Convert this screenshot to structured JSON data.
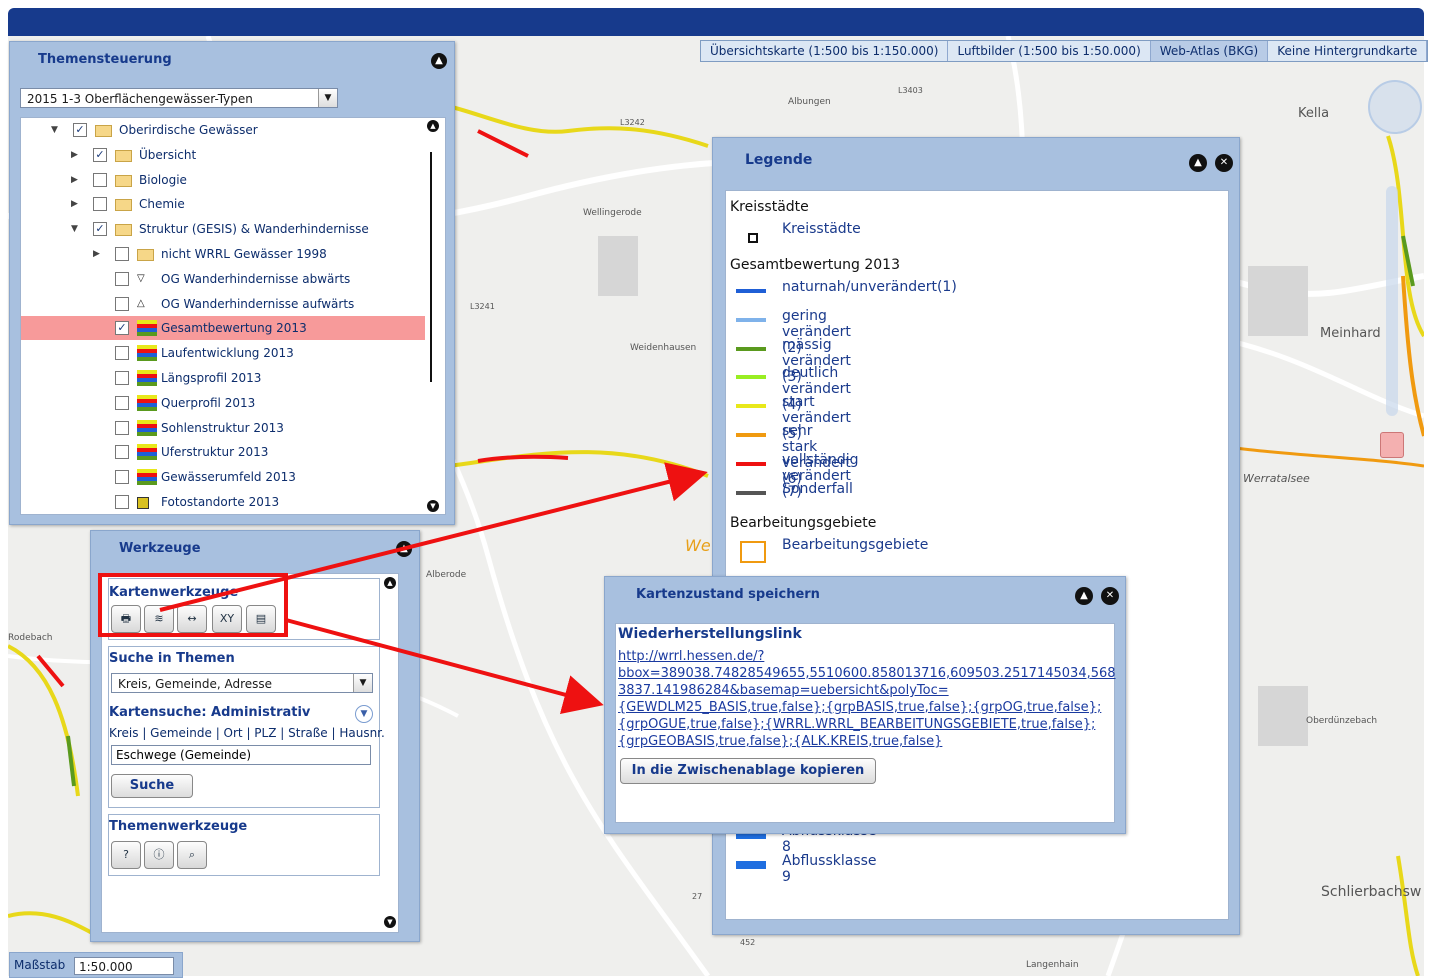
{
  "basemap_tabs": [
    {
      "label": "Übersichtskarte (1:500 bis 1:150.000)",
      "active": false
    },
    {
      "label": "Luftbilder (1:500 bis 1:50.000)",
      "active": false
    },
    {
      "label": "Web-Atlas (BKG)",
      "active": true
    },
    {
      "label": "Keine Hintergrundkarte",
      "active": false
    }
  ],
  "map_labels": {
    "kella": "Kella",
    "meinhard": "Meinhard",
    "schlierbach": "Schlierbachsw",
    "werratalsee": "Werratalsee",
    "we": "We",
    "alberode": "Alberode",
    "rodebach": "Rodebach",
    "weidenhausen": "Weidenhausen",
    "wellingerode": "Wellingerode",
    "langenhain": "Langenhain",
    "oberduenzebach": "Oberdünzebach",
    "albungen": "Albungen",
    "l3242": "L3242",
    "l3241": "L3241",
    "l3403": "L3403",
    "n452": "452",
    "n27": "27"
  },
  "themen": {
    "title": "Themensteuerung",
    "dropdown": "2015 1-3 Oberflächengewässer-Typen",
    "tree": [
      {
        "label": "Oberirdische Gewässer",
        "indent": 0,
        "arrow": "▼",
        "checked": true,
        "icon": "folder-open"
      },
      {
        "label": "Übersicht",
        "indent": 1,
        "arrow": "▶",
        "checked": true,
        "icon": "folder"
      },
      {
        "label": "Biologie",
        "indent": 1,
        "arrow": "▶",
        "checked": false,
        "icon": "folder"
      },
      {
        "label": "Chemie",
        "indent": 1,
        "arrow": "▶",
        "checked": false,
        "icon": "folder"
      },
      {
        "label": "Struktur (GESIS) & Wanderhindernisse",
        "indent": 1,
        "arrow": "▼",
        "checked": true,
        "icon": "folder-open"
      },
      {
        "label": "nicht WRRL Gewässer 1998",
        "indent": 2,
        "arrow": "▶",
        "checked": false,
        "icon": "folder"
      },
      {
        "label": "OG Wanderhindernisse abwärts",
        "indent": 2,
        "arrow": "",
        "checked": false,
        "icon": "triangle-down"
      },
      {
        "label": "OG Wanderhindernisse aufwärts",
        "indent": 2,
        "arrow": "",
        "checked": false,
        "icon": "triangle-up"
      },
      {
        "label": "Gesamtbewertung 2013",
        "indent": 2,
        "arrow": "",
        "checked": true,
        "icon": "ramp",
        "selected": true
      },
      {
        "label": "Laufentwicklung 2013",
        "indent": 2,
        "arrow": "",
        "checked": false,
        "icon": "ramp"
      },
      {
        "label": "Längsprofil 2013",
        "indent": 2,
        "arrow": "",
        "checked": false,
        "icon": "ramp"
      },
      {
        "label": "Querprofil 2013",
        "indent": 2,
        "arrow": "",
        "checked": false,
        "icon": "ramp"
      },
      {
        "label": "Sohlenstruktur 2013",
        "indent": 2,
        "arrow": "",
        "checked": false,
        "icon": "ramp"
      },
      {
        "label": "Uferstruktur 2013",
        "indent": 2,
        "arrow": "",
        "checked": false,
        "icon": "ramp"
      },
      {
        "label": "Gewässerumfeld 2013",
        "indent": 2,
        "arrow": "",
        "checked": false,
        "icon": "ramp"
      },
      {
        "label": "Fotostandorte 2013",
        "indent": 2,
        "arrow": "",
        "checked": false,
        "icon": "square"
      }
    ]
  },
  "werkzeuge": {
    "title": "Werkzeuge",
    "kartenwerkzeuge": "Kartenwerkzeuge",
    "tools": [
      "print-icon",
      "layers-icon",
      "measure-icon",
      "coordinates-icon",
      "document-icon"
    ],
    "tool_glyphs": [
      "🖶",
      "≋",
      "↔",
      "XY",
      "▤"
    ],
    "suche_title": "Suche in Themen",
    "suche_dropdown": "Kreis, Gemeinde, Adresse",
    "kartensuche_title": "Kartensuche: Administrativ",
    "kartensuche_options": "Kreis | Gemeinde | Ort | PLZ | Straße | Hausnr.",
    "search_value": "Eschwege (Gemeinde)",
    "suche_button": "Suche",
    "themenwerkzeuge": "Themenwerkzeuge"
  },
  "legende": {
    "title": "Legende",
    "kreis_head": "Kreisstädte",
    "kreis_item": "Kreisstädte",
    "gesamt_head": "Gesamtbewertung 2013",
    "items": [
      {
        "label": "naturnah/unverändert(1)",
        "color": "#1f5fd6"
      },
      {
        "label": "gering verändert (2)",
        "color": "#7fb2ea"
      },
      {
        "label": "mässig verändert (3)",
        "color": "#5a9a1e"
      },
      {
        "label": "deutlich verändert (4)",
        "color": "#99ee22"
      },
      {
        "label": "start verändert (5)",
        "color": "#e8e81a"
      },
      {
        "label": "sehr stark verändert (6)",
        "color": "#f09a10"
      },
      {
        "label": "vollständig verändert (7)",
        "color": "#ee1111"
      },
      {
        "label": "Sonderfall",
        "color": "#555555"
      }
    ],
    "bearb_head": "Bearbeitungsgebiete",
    "bearb_item": "Bearbeitungsgebiete",
    "abfluss8": "Abflussklasse 8",
    "abfluss9": "Abflussklasse 9",
    "abfluss_color": "#1f6ee0"
  },
  "kartenzustand": {
    "title": "Kartenzustand speichern",
    "subtitle": "Wiederherstellungslink",
    "link_lines": [
      "http://wrrl.hessen.de/?",
      "bbox=389038.74828549655,5510600.858013716,609503.2517145034,568",
      "3837.141986284&basemap=uebersicht&polyToc=",
      "{GEWDLM25_BASIS,true,false};{grpBASIS,true,false};{grpOG,true,false};",
      "{grpOGUE,true,false};{WRRL.WRRL_BEARBEITUNGSGEBIETE,true,false};",
      "{grpGEOBASIS,true,false};{ALK.KREIS,true,false}"
    ],
    "copy_button": "In die Zwischenablage kopieren"
  },
  "massstab": {
    "label": "Maßstab",
    "value": "1:50.000"
  }
}
